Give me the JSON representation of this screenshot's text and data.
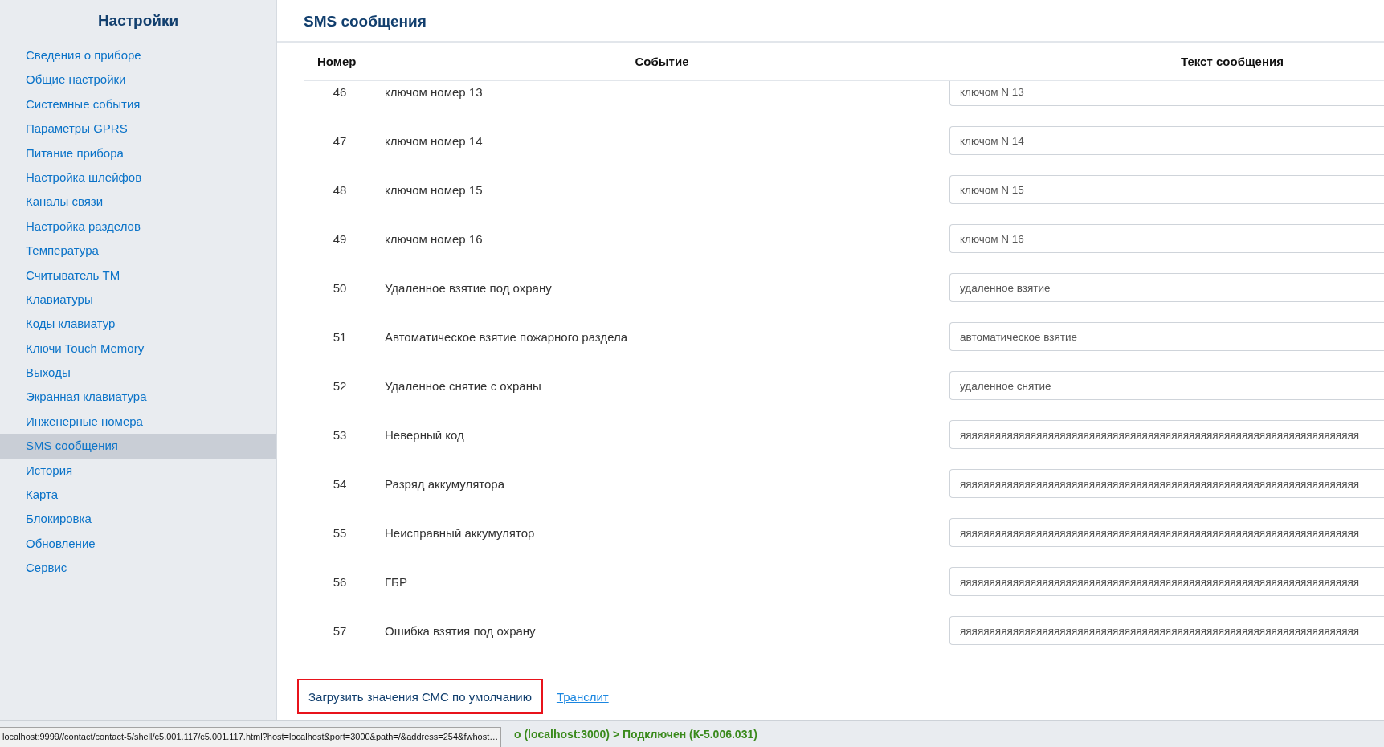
{
  "sidebar": {
    "title": "Настройки",
    "items": [
      {
        "label": "Сведения о приборе",
        "selected": false
      },
      {
        "label": "Общие настройки",
        "selected": false
      },
      {
        "label": "Системные события",
        "selected": false
      },
      {
        "label": "Параметры GPRS",
        "selected": false
      },
      {
        "label": "Питание прибора",
        "selected": false
      },
      {
        "label": "Настройка шлейфов",
        "selected": false
      },
      {
        "label": "Каналы связи",
        "selected": false
      },
      {
        "label": "Настройка разделов",
        "selected": false
      },
      {
        "label": "Температура",
        "selected": false
      },
      {
        "label": "Считыватель ТМ",
        "selected": false
      },
      {
        "label": "Клавиатуры",
        "selected": false
      },
      {
        "label": "Коды клавиатур",
        "selected": false
      },
      {
        "label": "Ключи Touch Memory",
        "selected": false
      },
      {
        "label": "Выходы",
        "selected": false
      },
      {
        "label": "Экранная клавиатура",
        "selected": false
      },
      {
        "label": "Инженерные номера",
        "selected": false
      },
      {
        "label": "SMS сообщения",
        "selected": true
      },
      {
        "label": "История",
        "selected": false
      },
      {
        "label": "Карта",
        "selected": false
      },
      {
        "label": "Блокировка",
        "selected": false
      },
      {
        "label": "Обновление",
        "selected": false
      },
      {
        "label": "Сервис",
        "selected": false
      }
    ]
  },
  "page": {
    "title": "SMS сообщения"
  },
  "table": {
    "columns": [
      "Номер",
      "Событие",
      "Текст сообщения"
    ],
    "rows": [
      {
        "number": "46",
        "event": "ключом номер 13",
        "message": "ключом N 13"
      },
      {
        "number": "47",
        "event": "ключом номер 14",
        "message": "ключом N 14"
      },
      {
        "number": "48",
        "event": "ключом номер 15",
        "message": "ключом N 15"
      },
      {
        "number": "49",
        "event": "ключом номер 16",
        "message": "ключом N 16"
      },
      {
        "number": "50",
        "event": "Удаленное взятие под охрану",
        "message": "удаленное взятие"
      },
      {
        "number": "51",
        "event": "Автоматическое взятие пожарного раздела",
        "message": "автоматическое взятие"
      },
      {
        "number": "52",
        "event": "Удаленное снятие с охраны",
        "message": "удаленное снятие"
      },
      {
        "number": "53",
        "event": "Неверный код",
        "message": "яяяяяяяяяяяяяяяяяяяяяяяяяяяяяяяяяяяяяяяяяяяяяяяяяяяяяяяяяяяяяяяяяяяя"
      },
      {
        "number": "54",
        "event": "Разряд аккумулятора",
        "message": "яяяяяяяяяяяяяяяяяяяяяяяяяяяяяяяяяяяяяяяяяяяяяяяяяяяяяяяяяяяяяяяяяяяя"
      },
      {
        "number": "55",
        "event": "Неисправный аккумулятор",
        "message": "яяяяяяяяяяяяяяяяяяяяяяяяяяяяяяяяяяяяяяяяяяяяяяяяяяяяяяяяяяяяяяяяяяяя"
      },
      {
        "number": "56",
        "event": "ГБР",
        "message": "яяяяяяяяяяяяяяяяяяяяяяяяяяяяяяяяяяяяяяяяяяяяяяяяяяяяяяяяяяяяяяяяяяяя"
      },
      {
        "number": "57",
        "event": "Ошибка взятия под охрану",
        "message": "яяяяяяяяяяяяяяяяяяяяяяяяяяяяяяяяяяяяяяяяяяяяяяяяяяяяяяяяяяяяяяяяяяяя"
      }
    ]
  },
  "actions": {
    "load_defaults": {
      "label": "Загрузить значения СМС по умолчанию",
      "focused": true
    },
    "translit_link": "Транслит"
  },
  "status_bar": {
    "text": "о (localhost:3000) > Подключен (К-5.006.031)"
  },
  "url_tooltip": "localhost:9999//contact/contact-5/shell/c5.001.117/c5.001.117.html?host=localhost&port=3000&path=/&address=254&fwhost…"
}
